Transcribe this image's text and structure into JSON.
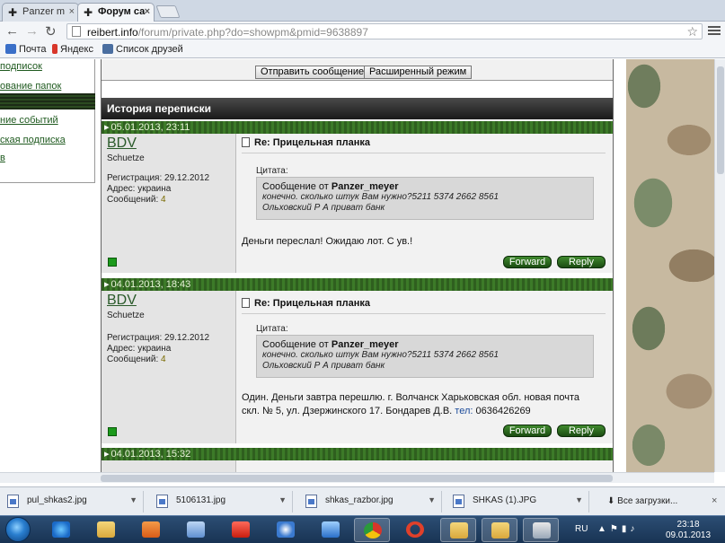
{
  "browser": {
    "tabs": [
      {
        "label": "Panzer m",
        "active": false
      },
      {
        "label": "Форум са",
        "active": true
      }
    ],
    "url_host": "reibert.info",
    "url_path": "/forum/private.php?do=showpm&pmid=9638897",
    "bookmarks": [
      {
        "label": "Почта",
        "icon": "mail-icon"
      },
      {
        "label": "Яндекс",
        "icon": "yandex-icon"
      },
      {
        "label": "Список друзей",
        "icon": "vk-icon"
      }
    ]
  },
  "leftnav": {
    "items": [
      "подписок",
      "ование папок",
      "ние событий",
      "ская подписка",
      "в"
    ]
  },
  "forum": {
    "send_button": "Отправить сообщение",
    "advanced_button": "Расширенный режим",
    "history_title": "История переписки",
    "registration_label": "Регистрация:",
    "address_label": "Адрес:",
    "messages_label": "Сообщений:",
    "quote_label": "Цитата:",
    "quote_from_label": "Сообщение от",
    "forward_label": "Forward",
    "reply_label": "Reply",
    "posts": [
      {
        "date": "05.01.2013, 23:11",
        "user": "BDV",
        "rank": "Schuetze",
        "registration": "29.12.2012",
        "address": "украина",
        "messages": "4",
        "title": "Re: Прицельная планка",
        "quote_author": "Panzer_meyer",
        "quote_line1": "конечно. сколько штук Вам нужно?5211 5374 2662 8561",
        "quote_line2": "Ольховский Р А приват банк",
        "text_line1": "Деньги переслал! Ожидаю лот. С ув.!",
        "text_line2": "",
        "phone_label": "",
        "phone": ""
      },
      {
        "date": "04.01.2013, 18:43",
        "user": "BDV",
        "rank": "Schuetze",
        "registration": "29.12.2012",
        "address": "украина",
        "messages": "4",
        "title": "Re: Прицельная планка",
        "quote_author": "Panzer_meyer",
        "quote_line1": "конечно. сколько штук Вам нужно?5211 5374 2662 8561",
        "quote_line2": "Ольховский Р А приват банк",
        "text_line1": "Один. Деньги завтра перешлю. г. Волчанск Харьковская обл. новая почта",
        "text_line2": "скл. № 5, ул. Дзержинского 17. Бондарев Д.В.",
        "phone_label": "тел:",
        "phone": "0636426269"
      },
      {
        "date": "04.01.2013, 15:32",
        "user": "",
        "title": ""
      }
    ]
  },
  "downloads": {
    "items": [
      "pul_shkas2.jpg",
      "5106131.jpg",
      "shkas_razbor.jpg",
      "SHKAS (1).JPG"
    ],
    "show_all": "Все загрузки..."
  },
  "taskbar": {
    "language": "RU",
    "time": "23:18",
    "date": "09.01.2013"
  }
}
